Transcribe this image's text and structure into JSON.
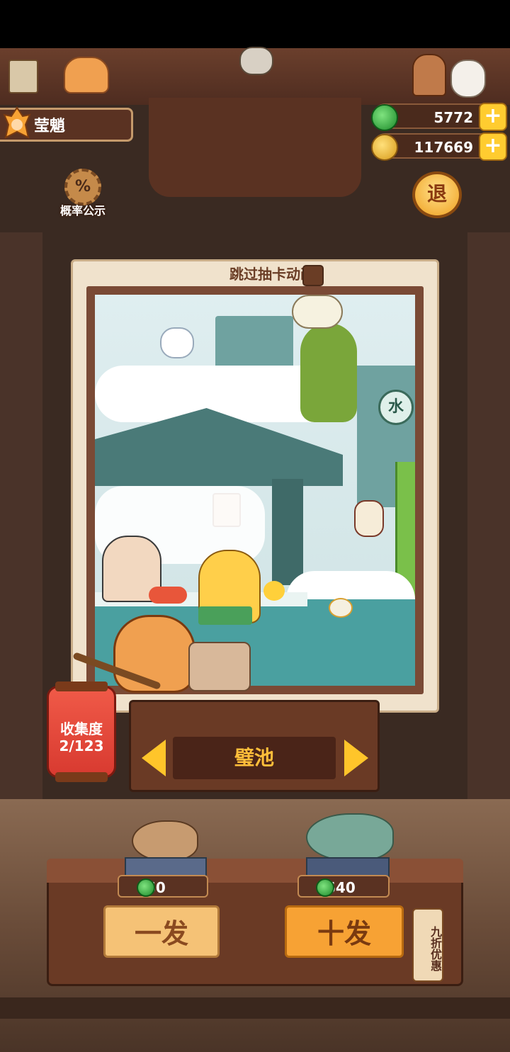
{
  "player": {
    "name": "莹魈"
  },
  "currency": {
    "gems": "5772",
    "coins": "117669",
    "plus_label": "+"
  },
  "probability": {
    "icon_text": "%",
    "label": "概率公示"
  },
  "exit": {
    "label": "退"
  },
  "skip_animation": {
    "label": "跳过抽卡动画",
    "checked": false
  },
  "card": {
    "name": "璧池",
    "art_labels": {
      "sign": "水"
    }
  },
  "collection": {
    "title": "收集度",
    "count": "2/123"
  },
  "draws": {
    "single": {
      "price": "60",
      "label": "一发"
    },
    "ten": {
      "price": "540",
      "label": "十发"
    },
    "discount_label": "九折优惠"
  },
  "colors": {
    "accent_gold": "#ffc52a",
    "wood_dark": "#4a2418",
    "button_single": "#f5c276",
    "button_ten": "#f7a234",
    "card_name_text": "#ffbe3a"
  },
  "icons": [
    "gem-icon",
    "coin-icon",
    "plus-icon",
    "percent-gear-icon",
    "arrow-left-icon",
    "arrow-right-icon"
  ]
}
